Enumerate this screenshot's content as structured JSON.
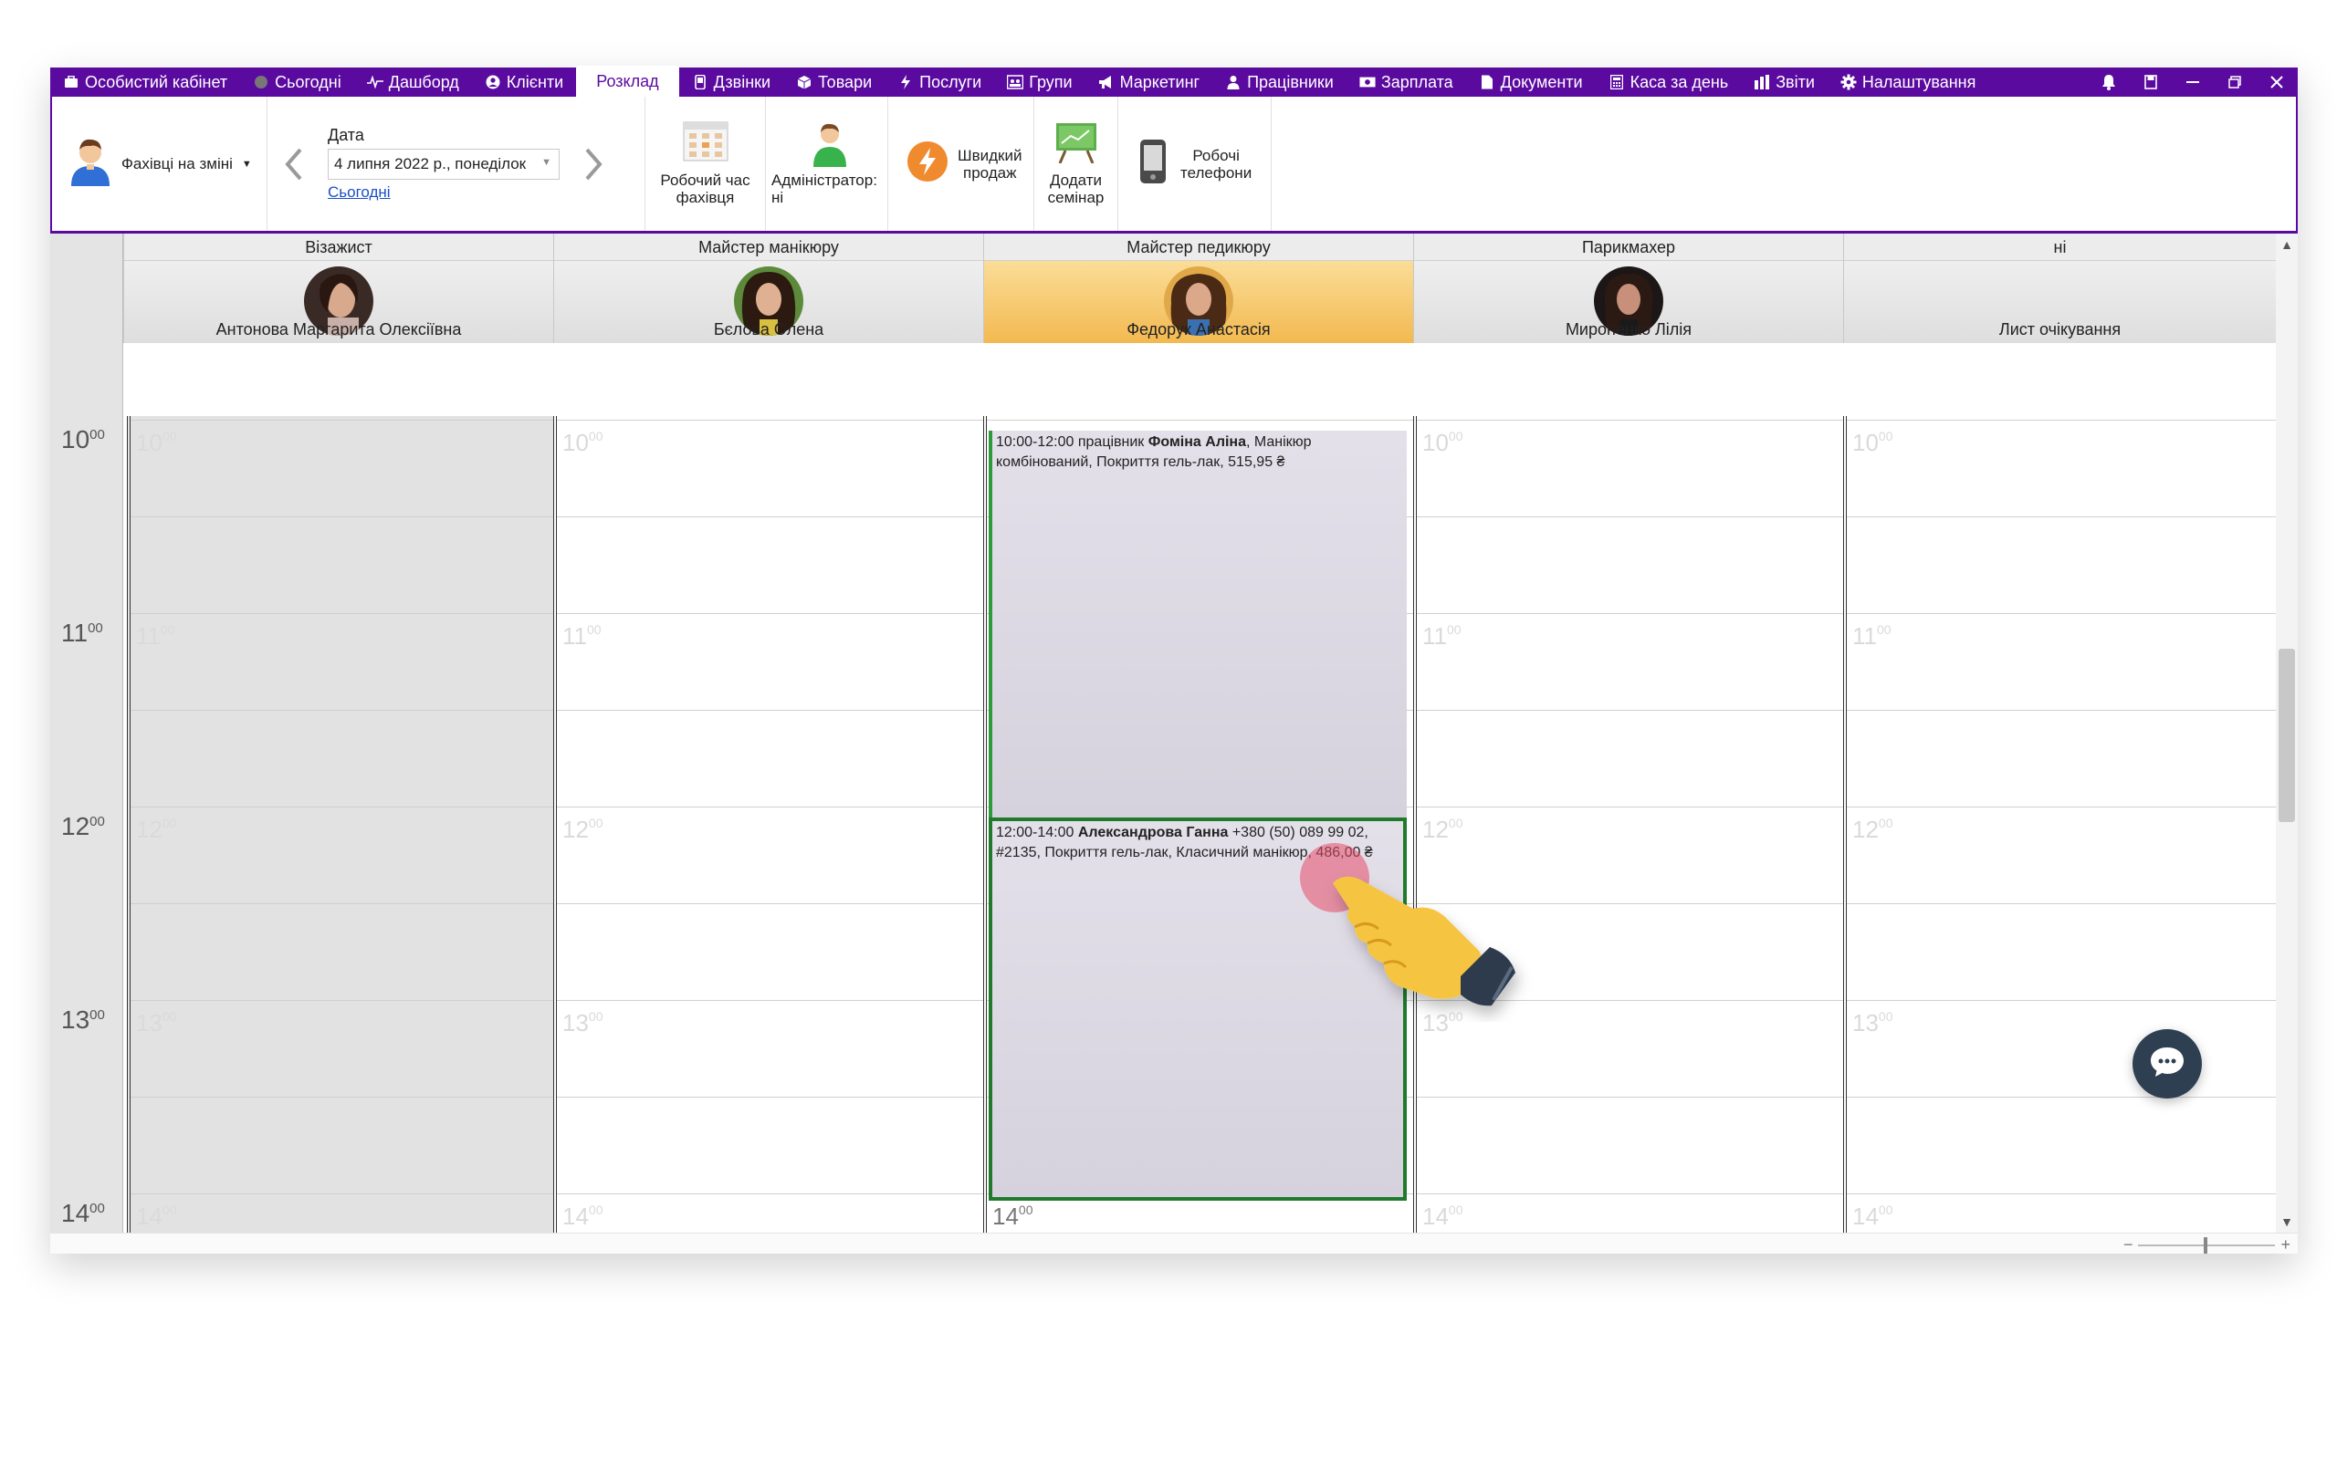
{
  "nav": {
    "items": [
      {
        "label": "Особистий кабінет",
        "icon": "briefcase-icon"
      },
      {
        "label": "Сьогодні",
        "icon": "globe-icon"
      },
      {
        "label": "Дашборд",
        "icon": "pulse-icon"
      },
      {
        "label": "Клієнти",
        "icon": "user-circle-icon"
      },
      {
        "label": "Розклад",
        "icon": "",
        "active": true
      },
      {
        "label": "Дзвінки",
        "icon": "phone-icon"
      },
      {
        "label": "Товари",
        "icon": "box-icon"
      },
      {
        "label": "Послуги",
        "icon": "lightning-icon"
      },
      {
        "label": "Групи",
        "icon": "group-icon"
      },
      {
        "label": "Маркетинг",
        "icon": "megaphone-icon"
      },
      {
        "label": "Працівники",
        "icon": "person-icon"
      },
      {
        "label": "Зарплата",
        "icon": "money-icon"
      },
      {
        "label": "Документи",
        "icon": "document-icon"
      },
      {
        "label": "Каса за день",
        "icon": "calculator-icon"
      },
      {
        "label": "Звіти",
        "icon": "bar-chart-icon"
      },
      {
        "label": "Налаштування",
        "icon": "gear-icon"
      }
    ],
    "accent": "#5b0aa0"
  },
  "ribbon": {
    "staff_label": "Фахівці на зміні",
    "date_label": "Дата",
    "date_value": "4 липня 2022 р., понеділок",
    "today_link": "Сьогодні",
    "work_time_label_1": "Робочий час",
    "work_time_label_2": "фахівця",
    "admin_label_1": "Адміністратор:",
    "admin_label_2": "ні",
    "quick_sale_label_1": "Швидкий",
    "quick_sale_label_2": "продаж",
    "seminar_label_1": "Додати",
    "seminar_label_2": "семінар",
    "phones_label_1": "Робочі",
    "phones_label_2": "телефони"
  },
  "columns": [
    {
      "title": "Візажист",
      "name": "Антонова Маргарита Олексіївна"
    },
    {
      "title": "Майстер манікюру",
      "name": "Бєлова Олена"
    },
    {
      "title": "Майстер педикюру",
      "name": "Федорук Анастасія",
      "selected": true
    },
    {
      "title": "Парикмахер",
      "name": "Мироненко Лілія"
    },
    {
      "title": "ні",
      "name": "Лист очікування"
    }
  ],
  "hours": [
    {
      "h": "10",
      "m": "00"
    },
    {
      "h": "11",
      "m": "00"
    },
    {
      "h": "12",
      "m": "00"
    },
    {
      "h": "13",
      "m": "00"
    },
    {
      "h": "14",
      "m": "00"
    }
  ],
  "appointments": [
    {
      "time": "10:00-12:00",
      "pre": " працівник ",
      "bold": "Фоміна Аліна",
      "post": ", Манікюр комбінований, Покриття гель-лак, 515,95 ₴"
    },
    {
      "time": "12:00-14:00",
      "pre": " ",
      "bold": "Александрова Ганна",
      "post": " +380 (50) 089 99 02, #2135, Покриття гель-лак, Класичний манікюр, 486,00 ₴"
    }
  ],
  "zoom": {
    "minus": "−",
    "plus": "+"
  }
}
